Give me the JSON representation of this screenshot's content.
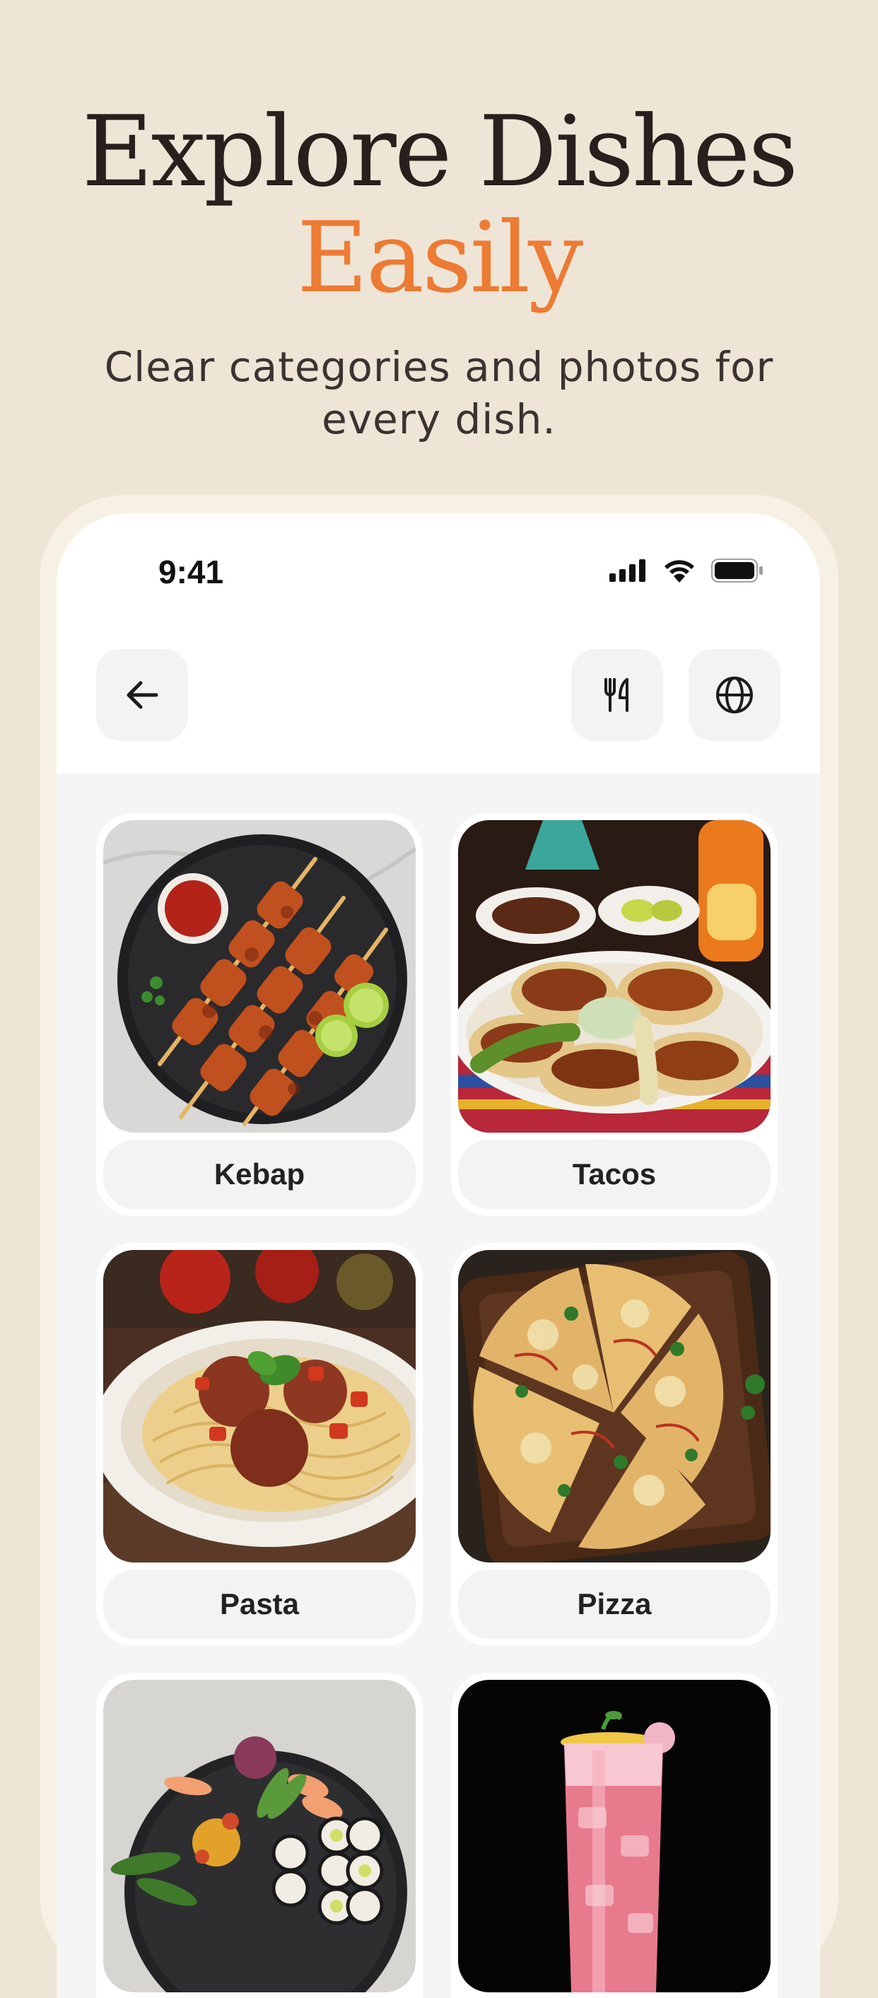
{
  "hero": {
    "title": "Explore Dishes",
    "title_accent": "Easily",
    "subtitle": "Clear categories and photos for every dish."
  },
  "status_bar": {
    "time": "9:41"
  },
  "nav": {
    "back_icon": "arrow-left-icon",
    "menu_icon": "fork-knife-icon",
    "language_icon": "globe-icon"
  },
  "categories": [
    {
      "label": "Kebap"
    },
    {
      "label": "Tacos"
    },
    {
      "label": "Pasta"
    },
    {
      "label": "Pizza"
    },
    {
      "label": ""
    },
    {
      "label": ""
    }
  ],
  "colors": {
    "background": "#efe5d6",
    "accent": "#ec7b34",
    "title": "#2a1f1d"
  }
}
